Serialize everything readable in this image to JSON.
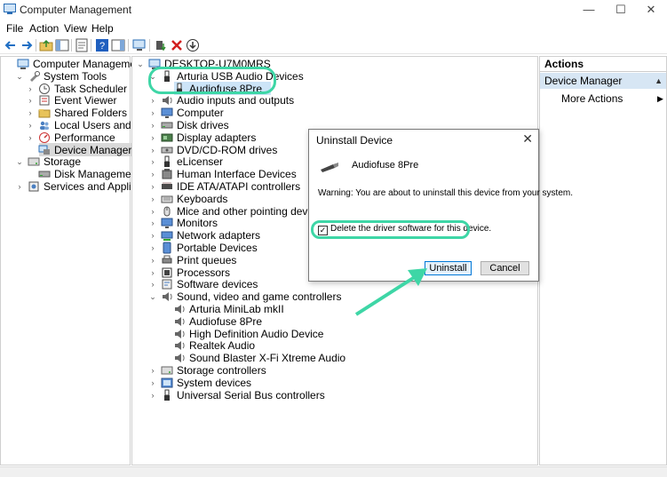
{
  "window": {
    "title": "Computer Management",
    "minimize": "—",
    "maximize": "☐",
    "close": "✕"
  },
  "menubar": [
    "File",
    "Action",
    "View",
    "Help"
  ],
  "left_tree": [
    {
      "label": "Computer Management (Local",
      "indent": 0,
      "exp": "",
      "icon": "computer-management-icon"
    },
    {
      "label": "System Tools",
      "indent": 1,
      "exp": "⌄",
      "icon": "tools-icon"
    },
    {
      "label": "Task Scheduler",
      "indent": 2,
      "exp": "›",
      "icon": "clock-icon"
    },
    {
      "label": "Event Viewer",
      "indent": 2,
      "exp": "›",
      "icon": "event-viewer-icon"
    },
    {
      "label": "Shared Folders",
      "indent": 2,
      "exp": "›",
      "icon": "folder-icon"
    },
    {
      "label": "Local Users and Groups",
      "indent": 2,
      "exp": "›",
      "icon": "users-icon"
    },
    {
      "label": "Performance",
      "indent": 2,
      "exp": "›",
      "icon": "performance-icon"
    },
    {
      "label": "Device Manager",
      "indent": 2,
      "exp": "",
      "icon": "device-manager-icon",
      "selected": true
    },
    {
      "label": "Storage",
      "indent": 1,
      "exp": "⌄",
      "icon": "storage-icon"
    },
    {
      "label": "Disk Management",
      "indent": 2,
      "exp": "",
      "icon": "disk-icon"
    },
    {
      "label": "Services and Applications",
      "indent": 1,
      "exp": "›",
      "icon": "services-icon"
    }
  ],
  "device_tree": [
    {
      "label": "DESKTOP-U7M0MRS",
      "indent": 0,
      "exp": "⌄",
      "icon": "computer-icon"
    },
    {
      "label": "Arturia USB Audio Devices",
      "indent": 1,
      "exp": "⌄",
      "icon": "usb-icon"
    },
    {
      "label": "Audiofuse 8Pre",
      "indent": 2,
      "exp": "",
      "icon": "usb-icon",
      "selected": true
    },
    {
      "label": "Audio inputs and outputs",
      "indent": 1,
      "exp": "›",
      "icon": "speaker-icon"
    },
    {
      "label": "Computer",
      "indent": 1,
      "exp": "›",
      "icon": "monitor-icon"
    },
    {
      "label": "Disk drives",
      "indent": 1,
      "exp": "›",
      "icon": "disk-icon"
    },
    {
      "label": "Display adapters",
      "indent": 1,
      "exp": "›",
      "icon": "display-icon"
    },
    {
      "label": "DVD/CD-ROM drives",
      "indent": 1,
      "exp": "›",
      "icon": "dvd-icon"
    },
    {
      "label": "eLicenser",
      "indent": 1,
      "exp": "›",
      "icon": "usb-icon"
    },
    {
      "label": "Human Interface Devices",
      "indent": 1,
      "exp": "›",
      "icon": "hid-icon"
    },
    {
      "label": "IDE ATA/ATAPI controllers",
      "indent": 1,
      "exp": "›",
      "icon": "ide-icon"
    },
    {
      "label": "Keyboards",
      "indent": 1,
      "exp": "›",
      "icon": "keyboard-icon"
    },
    {
      "label": "Mice and other pointing devices",
      "indent": 1,
      "exp": "›",
      "icon": "mouse-icon"
    },
    {
      "label": "Monitors",
      "indent": 1,
      "exp": "›",
      "icon": "monitor-icon"
    },
    {
      "label": "Network adapters",
      "indent": 1,
      "exp": "›",
      "icon": "network-icon"
    },
    {
      "label": "Portable Devices",
      "indent": 1,
      "exp": "›",
      "icon": "portable-icon"
    },
    {
      "label": "Print queues",
      "indent": 1,
      "exp": "›",
      "icon": "printer-icon"
    },
    {
      "label": "Processors",
      "indent": 1,
      "exp": "›",
      "icon": "processor-icon"
    },
    {
      "label": "Software devices",
      "indent": 1,
      "exp": "›",
      "icon": "software-icon"
    },
    {
      "label": "Sound, video and game controllers",
      "indent": 1,
      "exp": "⌄",
      "icon": "speaker-icon"
    },
    {
      "label": "Arturia MiniLab mkII",
      "indent": 2,
      "exp": "",
      "icon": "speaker-icon"
    },
    {
      "label": "Audiofuse 8Pre",
      "indent": 2,
      "exp": "",
      "icon": "speaker-icon"
    },
    {
      "label": "High Definition Audio Device",
      "indent": 2,
      "exp": "",
      "icon": "speaker-icon"
    },
    {
      "label": "Realtek Audio",
      "indent": 2,
      "exp": "",
      "icon": "speaker-icon"
    },
    {
      "label": "Sound Blaster X-Fi Xtreme Audio",
      "indent": 2,
      "exp": "",
      "icon": "speaker-icon"
    },
    {
      "label": "Storage controllers",
      "indent": 1,
      "exp": "›",
      "icon": "storage-icon"
    },
    {
      "label": "System devices",
      "indent": 1,
      "exp": "›",
      "icon": "system-icon"
    },
    {
      "label": "Universal Serial Bus controllers",
      "indent": 1,
      "exp": "›",
      "icon": "usb-icon"
    }
  ],
  "actions": {
    "header": "Actions",
    "section": "Device Manager",
    "more": "More Actions"
  },
  "dialog": {
    "title": "Uninstall Device",
    "close": "✕",
    "device_name": "Audiofuse 8Pre",
    "warning": "Warning: You are about to uninstall this device from your system.",
    "checkbox_label": "Delete the driver software for this device.",
    "checkbox_checked": true,
    "uninstall_label": "Uninstall",
    "cancel_label": "Cancel"
  },
  "colors": {
    "highlight": "#3ed6a6",
    "selection": "#cce4f7",
    "actions_band": "#d7e6f4"
  }
}
